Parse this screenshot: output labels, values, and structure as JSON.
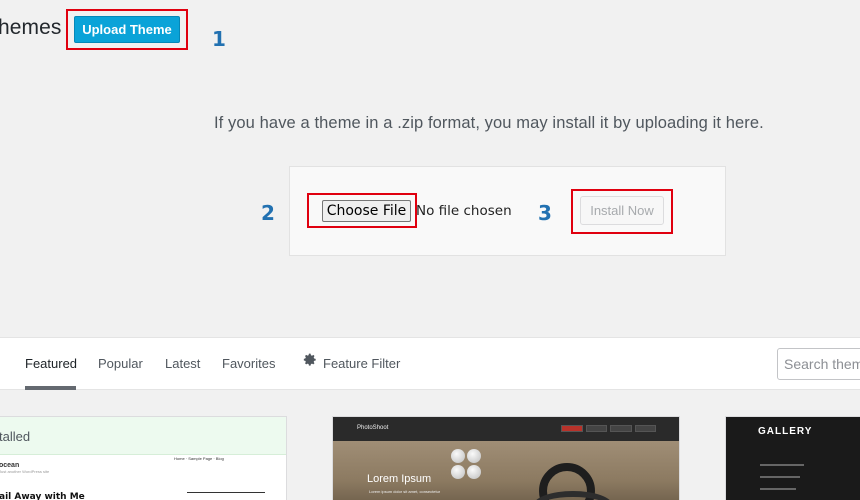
{
  "header": {
    "title": "hemes",
    "upload_button": "Upload Theme"
  },
  "steps": [
    "1",
    "2",
    "3"
  ],
  "upload": {
    "info": "If you have a theme in a .zip format, you may install it by uploading it here.",
    "choose_file": "Choose File",
    "no_file": "No file chosen",
    "install": "Install Now"
  },
  "filters": {
    "items": [
      {
        "label": "Featured",
        "active": true
      },
      {
        "label": "Popular"
      },
      {
        "label": "Latest"
      },
      {
        "label": "Favorites"
      },
      {
        "label": "Feature Filter",
        "icon": "gear-icon"
      }
    ],
    "search_placeholder": "Search themes..."
  },
  "themes": {
    "card1": {
      "installed_label": "talled",
      "heading": "ail Away with Me"
    },
    "card2": {
      "brand": "PhotoShoot",
      "title": "Lorem Ipsum"
    },
    "card3": {
      "logo": "GALLERY"
    }
  },
  "colors": {
    "accent": "#0aa3d8",
    "highlight": "#e0000f",
    "step_number": "#2271b1"
  }
}
